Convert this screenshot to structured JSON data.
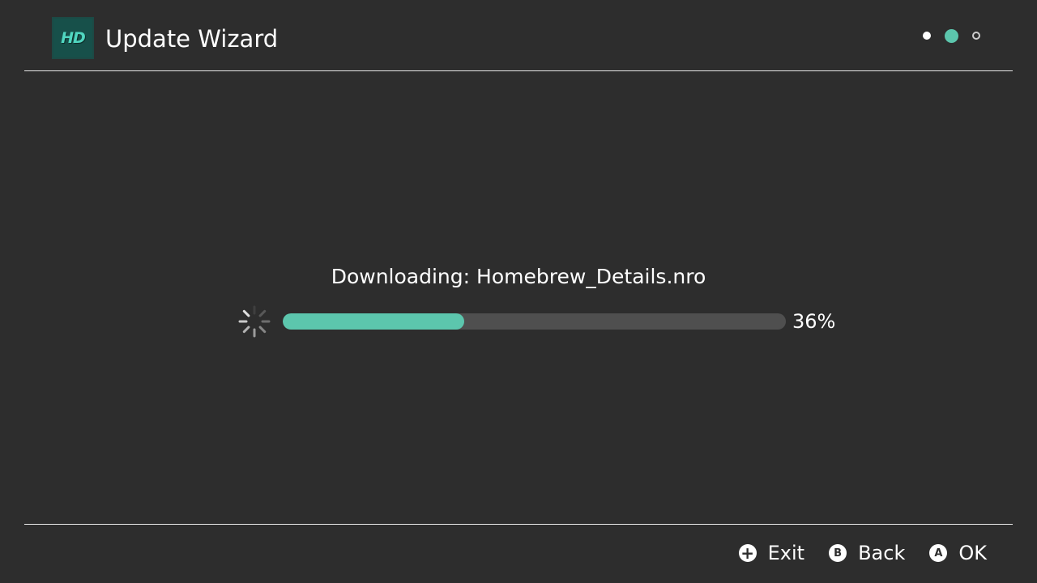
{
  "header": {
    "app_icon_text": "HD",
    "title": "Update Wizard",
    "steps": {
      "total": 3,
      "current": 2
    }
  },
  "main": {
    "status_text": "Downloading: Homebrew_Details.nro",
    "progress": {
      "fraction": 0.36,
      "label": "36%"
    }
  },
  "footer": {
    "actions": [
      {
        "icon": "plus-button-icon",
        "glyph": "+",
        "label": "Exit"
      },
      {
        "icon": "b-button-icon",
        "glyph": "B",
        "label": "Back"
      },
      {
        "icon": "a-button-icon",
        "glyph": "A",
        "label": "OK"
      }
    ]
  },
  "colors": {
    "background": "#2d2d2d",
    "accent": "#5cc6ad",
    "track": "#4f4f4f",
    "text": "#ffffff"
  }
}
